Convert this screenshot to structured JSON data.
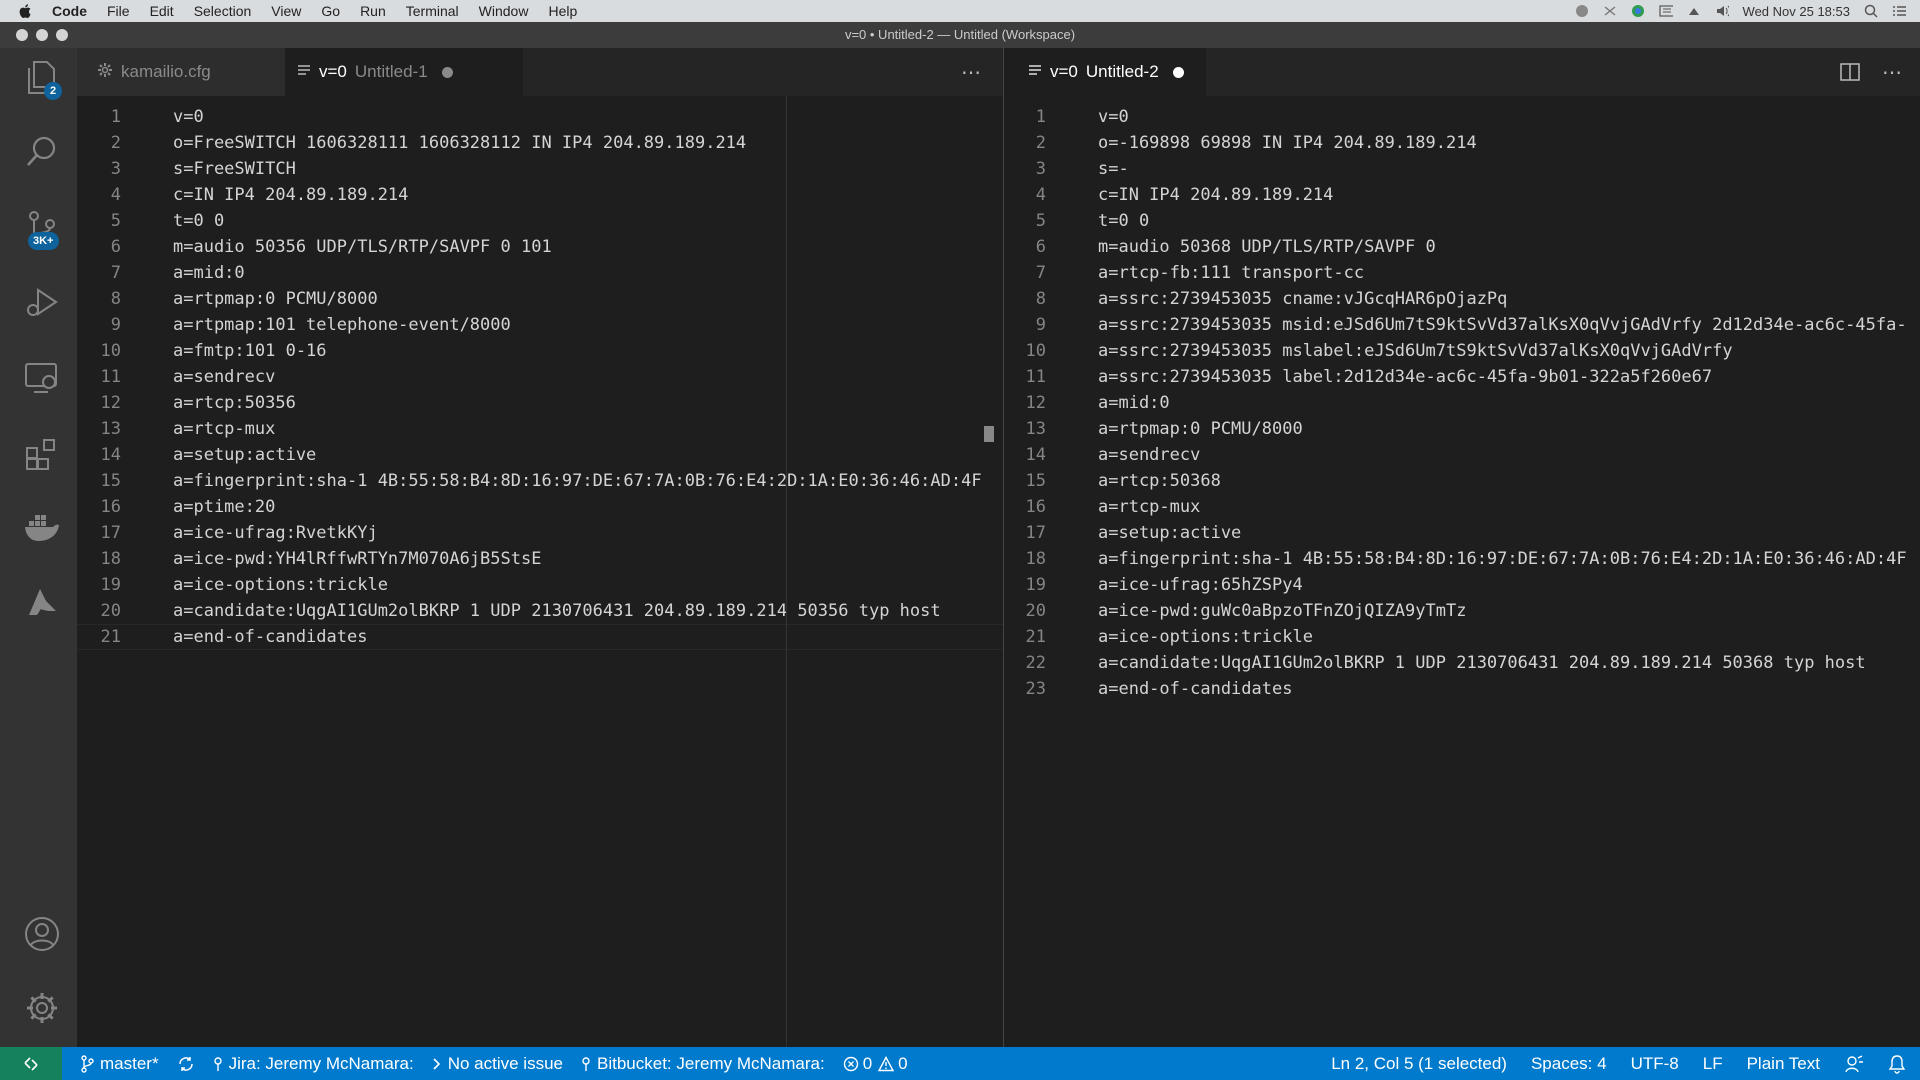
{
  "menubar": {
    "items": [
      "Code",
      "File",
      "Edit",
      "Selection",
      "View",
      "Go",
      "Run",
      "Terminal",
      "Window",
      "Help"
    ],
    "clock": "Wed Nov 25  18:53"
  },
  "window": {
    "title": "v=0 • Untitled-2 — Untitled (Workspace)"
  },
  "activitybar": {
    "explorer_badge": "2",
    "scm_badge": "3K+"
  },
  "left_group": {
    "tabs": [
      {
        "prefix": "",
        "name": "kamailio.cfg",
        "icon": "gear-icon"
      },
      {
        "prefix": "v=0",
        "name": "Untitled-1",
        "icon": "list-icon",
        "dirty": true
      }
    ],
    "lines": [
      "v=0",
      "o=FreeSWITCH 1606328111 1606328112 IN IP4 204.89.189.214",
      "s=FreeSWITCH",
      "c=IN IP4 204.89.189.214",
      "t=0 0",
      "m=audio 50356 UDP/TLS/RTP/SAVPF 0 101",
      "a=mid:0",
      "a=rtpmap:0 PCMU/8000",
      "a=rtpmap:101 telephone-event/8000",
      "a=fmtp:101 0-16",
      "a=sendrecv",
      "a=rtcp:50356",
      "a=rtcp-mux",
      "a=setup:active",
      "a=fingerprint:sha-1 4B:55:58:B4:8D:16:97:DE:67:7A:0B:76:E4:2D:1A:E0:36:46:AD:4F",
      "a=ptime:20",
      "a=ice-ufrag:RvetkKYj",
      "a=ice-pwd:YH4lRffwRTYn7M070A6jB5StsE",
      "a=ice-options:trickle",
      "a=candidate:UqgAI1GUm2olBKRP 1 UDP 2130706431 204.89.189.214 50356 typ host",
      "a=end-of-candidates"
    ]
  },
  "right_group": {
    "tabs": [
      {
        "prefix": "v=0",
        "name": "Untitled-2",
        "icon": "list-icon",
        "dirty": true
      }
    ],
    "lines": [
      "v=0",
      "o=-169898 69898 IN IP4 204.89.189.214",
      "s=-",
      "c=IN IP4 204.89.189.214",
      "t=0 0",
      "m=audio 50368 UDP/TLS/RTP/SAVPF 0",
      "a=rtcp-fb:111 transport-cc",
      "a=ssrc:2739453035 cname:vJGcqHAR6pOjazPq",
      "a=ssrc:2739453035 msid:eJSd6Um7tS9ktSvVd37alKsX0qVvjGAdVrfy 2d12d34e-ac6c-45fa-",
      "a=ssrc:2739453035 mslabel:eJSd6Um7tS9ktSvVd37alKsX0qVvjGAdVrfy",
      "a=ssrc:2739453035 label:2d12d34e-ac6c-45fa-9b01-322a5f260e67",
      "a=mid:0",
      "a=rtpmap:0 PCMU/8000",
      "a=sendrecv",
      "a=rtcp:50368",
      "a=rtcp-mux",
      "a=setup:active",
      "a=fingerprint:sha-1 4B:55:58:B4:8D:16:97:DE:67:7A:0B:76:E4:2D:1A:E0:36:46:AD:4F",
      "a=ice-ufrag:65hZSPy4",
      "a=ice-pwd:guWc0aBpzoTFnZOjQIZA9yTmTz",
      "a=ice-options:trickle",
      "a=candidate:UqgAI1GUm2olBKRP 1 UDP 2130706431 204.89.189.214 50368 typ host",
      "a=end-of-candidates"
    ]
  },
  "statusbar": {
    "branch": "master*",
    "jira": "Jira: Jeremy McNamara:",
    "issue": "No active issue",
    "bitbucket": "Bitbucket: Jeremy McNamara:",
    "errors": "0",
    "warnings": "0",
    "cursor": "Ln 2, Col 5 (1 selected)",
    "spaces": "Spaces: 4",
    "encoding": "UTF-8",
    "eol": "LF",
    "language": "Plain Text"
  },
  "colors": {
    "accent": "#007acc",
    "remote": "#16825d",
    "badge": "#0e639c"
  }
}
